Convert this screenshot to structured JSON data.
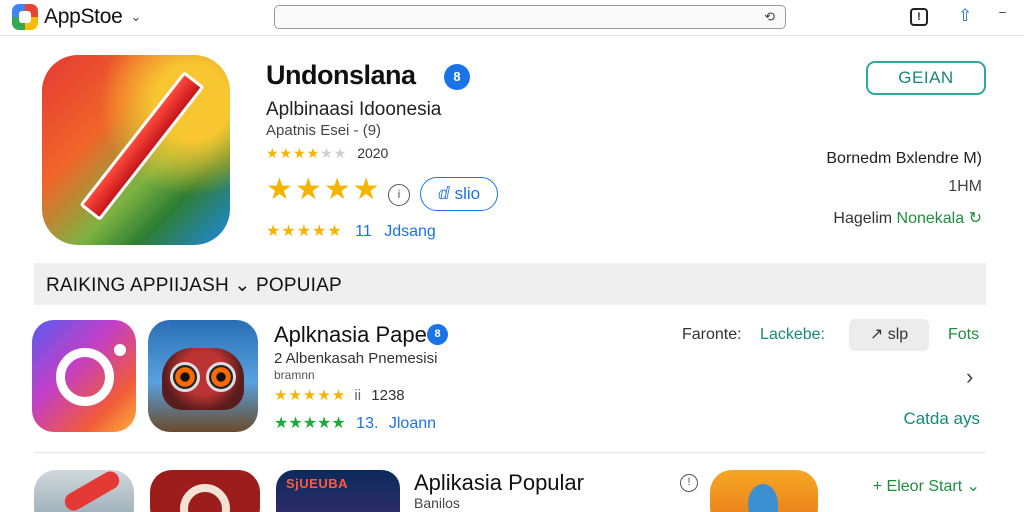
{
  "topbar": {
    "brand": "AppStoe",
    "brand_chevron": "⌄",
    "search_value": "",
    "search_icon": "⟲",
    "info_icon": "!",
    "share_icon": "⇧",
    "more_icon": "⁻"
  },
  "hero": {
    "title": "Undonslana",
    "verified_mark": "8",
    "subtitle": "Aplbinaasi Idoonesia",
    "meta": "Apatnis Esei - (9)",
    "small_rating": {
      "stars_on": "★★★★",
      "stars_off": "★★",
      "value": "2020"
    },
    "big_rating": "★★★★",
    "info_icon": "i",
    "chip_label": "ⅆ slio",
    "rating_row": {
      "stars": "★★★★★",
      "count": "11",
      "link": "Jdsang"
    },
    "get_button": "GEIAN",
    "right_info": [
      {
        "text": "Bornedm Bxlendre M)"
      },
      {
        "text": "1HM"
      },
      {
        "label": "Hagelim",
        "value": "Nonekala",
        "icon": "↻"
      }
    ]
  },
  "section": {
    "title": "RAIKING APPIIJASH ⌄ POPUIAP"
  },
  "list": [
    {
      "title": "Aplknasia Pape",
      "verified_mark": "8",
      "subtitle": "2 Albenkasah Pnemesisi",
      "subtitle2": "bramnn",
      "rating": {
        "stars": "★★★★★",
        "sep": "ii",
        "value": "1238"
      },
      "rating2": {
        "stars": "★★★★★",
        "count": "13.",
        "link": "Jloann"
      },
      "right_label": "Faronte:",
      "right_value": "Lackebe:",
      "pill": "↗ slp",
      "fots": "Fots",
      "chevron": "›",
      "catda": "Catda ays"
    },
    {
      "tile_label": "SjUEUBA",
      "title": "Aplikasia Popular",
      "subtitle": "Banilos",
      "info_icon": "!",
      "right_text": "+ Eleor Start ⌄"
    }
  ],
  "colors": {
    "accent_blue": "#1a73e8",
    "teal": "#158a7a",
    "green": "#1e8e3e",
    "star": "#f5b400"
  }
}
